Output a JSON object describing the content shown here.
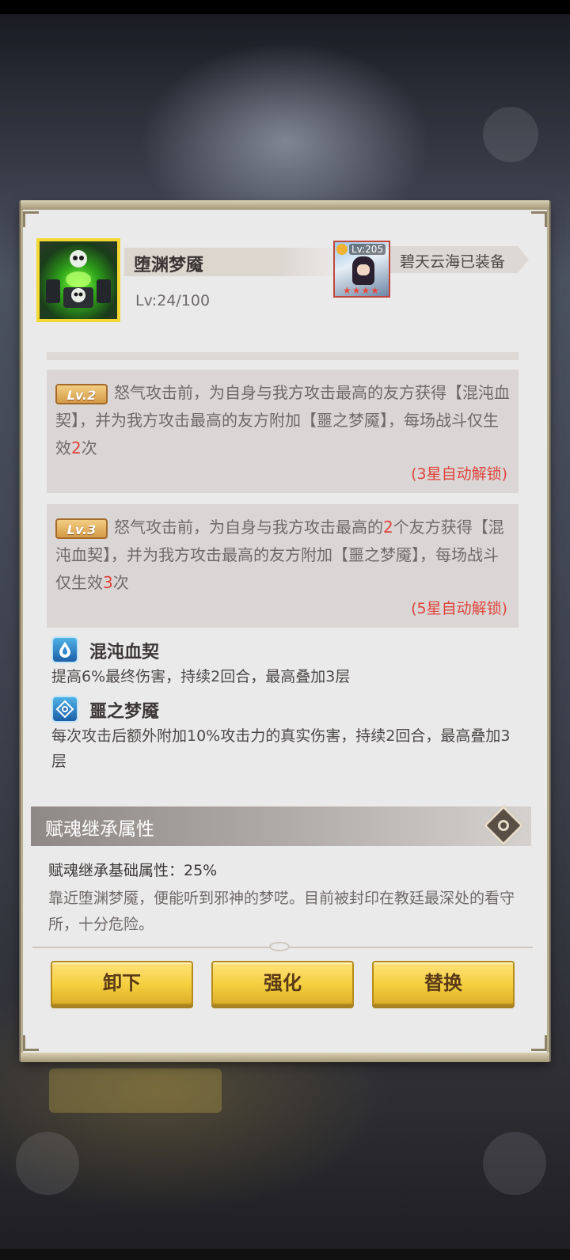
{
  "item": {
    "name": "堕渊梦魇",
    "level": "Lv:24/100"
  },
  "equipped": {
    "hero_level": "Lv:205",
    "text": "碧天云海已装备"
  },
  "skills": [
    {
      "badge": "Lv.2",
      "text_a": "怒气攻击前，为自身与我方攻击最高的友方获得【混沌血契】，并为我方攻击最高的友方附加【噩之梦魇】，每场战斗仅生效",
      "highlight_a": "2",
      "text_b": "次",
      "highlight_b": "",
      "text_c": "",
      "unlock": "(3星自动解锁)"
    },
    {
      "badge": "Lv.3",
      "text_a": "怒气攻击前，为自身与我方攻击最高的",
      "highlight_a": "2",
      "text_b": "个友方获得【混沌血契】，并为我方攻击最高的友方附加【噩之梦魇】，每场战斗仅生效",
      "highlight_b": "3",
      "text_c": "次",
      "unlock": "(5星自动解锁)"
    }
  ],
  "buffs": [
    {
      "icon": "water-drop-icon",
      "title": "混沌血契",
      "desc": "提高6%最终伤害，持续2回合，最高叠加3层"
    },
    {
      "icon": "eye-sigil-icon",
      "title": "噩之梦魇",
      "desc": "每次攻击后额外附加10%攻击力的真实伤害，持续2回合，最高叠加3层"
    }
  ],
  "inherit": {
    "title": "赋魂继承属性",
    "base_label": "赋魂继承基础属性：25%",
    "lore": "靠近堕渊梦魇，便能听到邪神的梦呓。目前被封印在教廷最深处的看守所，十分危险。"
  },
  "buttons": {
    "unequip": "卸下",
    "enhance": "强化",
    "replace": "替换"
  },
  "colors": {
    "highlight_red": "#e0443c",
    "button_yellow": "#f4cf3e",
    "frame_gold": "#f3d832"
  }
}
